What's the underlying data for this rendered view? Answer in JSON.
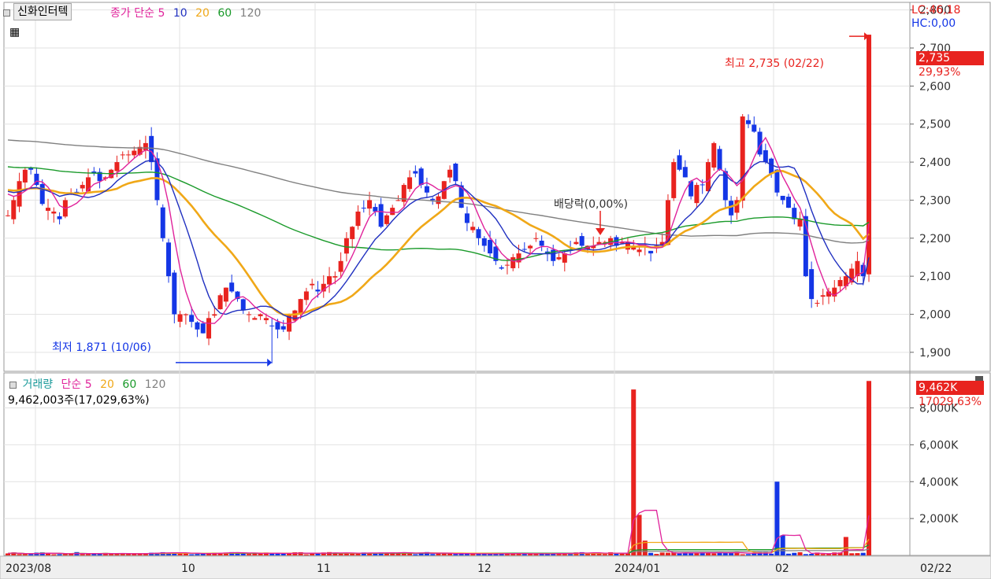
{
  "header": {
    "stock_name": "신화인터텍",
    "price_label": "종가",
    "ma_label": "단순",
    "ma_periods": [
      "5",
      "10",
      "20",
      "60",
      "120"
    ],
    "lc": "LC:46,18",
    "hc": "HC:0,00"
  },
  "volume_header": {
    "label": "거래량",
    "ma_label": "단순",
    "ma_periods": [
      "5",
      "20",
      "60",
      "120"
    ],
    "current": "9,462,003주(17,029,63%)"
  },
  "annotations": {
    "high": "최고 2,735 (02/22)",
    "low": "최저 1,871 (10/06)",
    "dividend": "배당락(0,00%)"
  },
  "badges": {
    "price_value": "2,735",
    "price_pct": "29,93%",
    "volume_value": "9,462K",
    "volume_pct": "17029,63%"
  },
  "colors": {
    "up": "#e8231f",
    "down": "#1436e6",
    "ma5": "#e0239b",
    "ma10": "#2030c0",
    "ma20": "#f0a818",
    "ma60": "#1a9a2a",
    "ma120": "#808080"
  },
  "chart_data": [
    {
      "type": "candlestick",
      "x_labels": [
        "2023/08",
        "10",
        "11",
        "12",
        "2024/01",
        "02",
        "02/22"
      ],
      "y_ticks": [
        "1,900",
        "2,000",
        "2,100",
        "2,200",
        "2,300",
        "2,400",
        "2,500",
        "2,600",
        "2,700",
        "2,800"
      ],
      "ylim": [
        1850,
        2820
      ],
      "grid": true,
      "closes": [
        2260,
        2300,
        2350,
        2380,
        2380,
        2340,
        2290,
        2280,
        2270,
        2250,
        2300,
        2320,
        2320,
        2340,
        2360,
        2370,
        2350,
        2360,
        2380,
        2400,
        2420,
        2420,
        2430,
        2440,
        2450,
        2400,
        2300,
        2200,
        2100,
        2000,
        2000,
        2000,
        1980,
        1960,
        1950,
        1990,
        2000,
        2050,
        2070,
        2060,
        2040,
        2010,
        2000,
        1990,
        2000,
        1990,
        1970,
        1960,
        1960,
        2000,
        2010,
        2040,
        2060,
        2080,
        2060,
        2080,
        2100,
        2100,
        2140,
        2200,
        2230,
        2270,
        2280,
        2300,
        2270,
        2230,
        2260,
        2280,
        2300,
        2340,
        2360,
        2370,
        2340,
        2320,
        2300,
        2310,
        2350,
        2380,
        2350,
        2280,
        2240,
        2230,
        2200,
        2180,
        2160,
        2140,
        2120,
        2130,
        2150,
        2160,
        2170,
        2180,
        2200,
        2180,
        2160,
        2140,
        2150,
        2160,
        2170,
        2190,
        2180,
        2180,
        2180,
        2190,
        2190,
        2200,
        2180,
        2190,
        2190,
        2180,
        2170,
        2180,
        2160,
        2180,
        2190,
        2300,
        2400,
        2380,
        2360,
        2310,
        2340,
        2340,
        2400,
        2450,
        2380,
        2300,
        2260,
        2300,
        2520,
        2500,
        2480,
        2420,
        2400,
        2370,
        2320,
        2300,
        2280,
        2250,
        2250,
        2100,
        2040,
        2030,
        2050,
        2060,
        2070,
        2090,
        2100,
        2120,
        2140,
        2100,
        2735
      ],
      "ma_series": [
        {
          "key": "ma5",
          "name": "5"
        },
        {
          "key": "ma10",
          "name": "10"
        },
        {
          "key": "ma20",
          "name": "20"
        },
        {
          "key": "ma60",
          "name": "60"
        },
        {
          "key": "ma120",
          "name": "120"
        }
      ],
      "annotated_high": {
        "value": 2735,
        "date": "02/22"
      },
      "annotated_low": {
        "value": 1871,
        "date": "10/06"
      }
    },
    {
      "type": "bar",
      "title": "거래량",
      "y_ticks": [
        "2,000K",
        "4,000K",
        "6,000K",
        "8,000K"
      ],
      "ylim": [
        0,
        9900
      ],
      "notable_volumes_k": [
        {
          "date": "2024/01",
          "value": 9000
        },
        {
          "date": "02",
          "value": 4000
        },
        {
          "date": "02",
          "value": 1000
        },
        {
          "date": "02/22",
          "value": 9462
        }
      ],
      "baseline_k": 120
    }
  ]
}
